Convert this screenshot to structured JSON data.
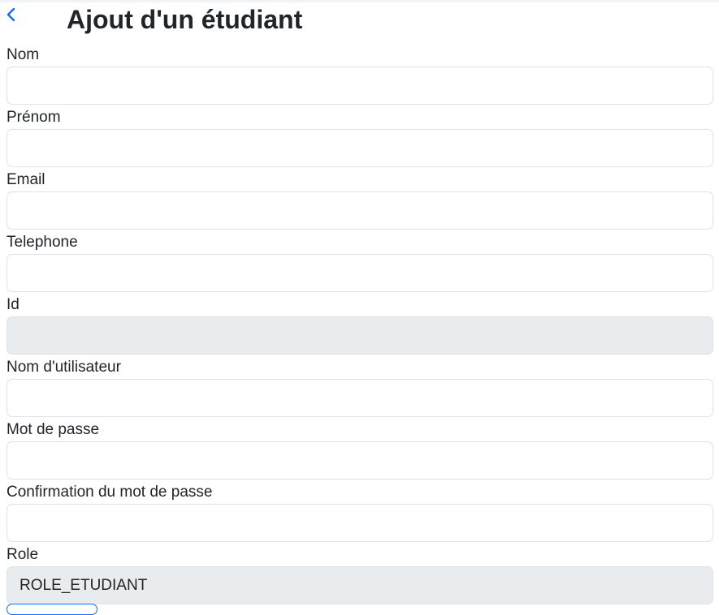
{
  "header": {
    "title": "Ajout d'un étudiant",
    "back_icon": "chevron-left-icon",
    "accent_color": "#0d6efd"
  },
  "form": {
    "fields": [
      {
        "label": "Nom",
        "value": ""
      },
      {
        "label": "Prénom",
        "value": ""
      },
      {
        "label": "Email",
        "value": ""
      },
      {
        "label": "Telephone",
        "value": ""
      },
      {
        "label": "Id",
        "value": ""
      },
      {
        "label": "Nom d'utilisateur",
        "value": ""
      },
      {
        "label": "Mot de passe",
        "value": ""
      },
      {
        "label": "Confirmation du mot de passe",
        "value": ""
      },
      {
        "label": "Role",
        "value": "ROLE_ETUDIANT"
      }
    ]
  }
}
